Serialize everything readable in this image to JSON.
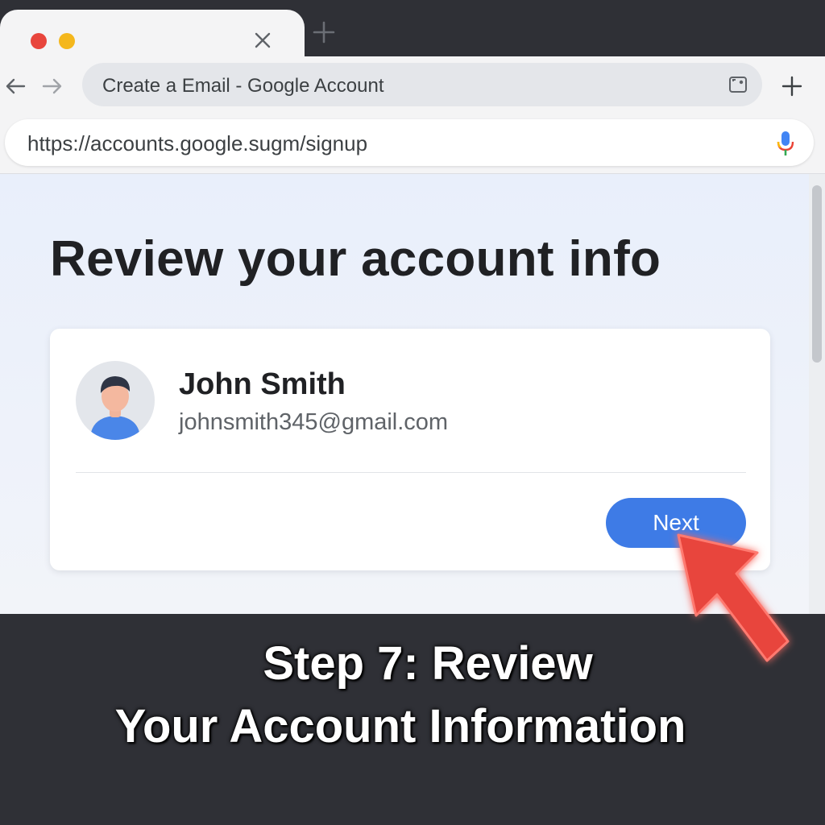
{
  "browser": {
    "tab_title": "Create a Email - Google Account",
    "url": "https://accounts.google.sugm/signup"
  },
  "page": {
    "heading": "Review your account info",
    "account": {
      "name": "John Smith",
      "email": "johnsmith345@gmail.com"
    },
    "next_button_label": "Next"
  },
  "caption": {
    "line1": "Step 7: Review",
    "line2": "Your Account Information"
  },
  "icons": {
    "close": "close-icon",
    "new_tab": "plus-icon",
    "back": "arrow-left-icon",
    "forward": "arrow-right-icon",
    "tab_action": "screenshot-icon",
    "mic": "microphone-icon",
    "pointer": "red-arrow-pointer-icon"
  },
  "colors": {
    "accent": "#3e7be6",
    "pointer": "#e8453c",
    "chrome_dark": "#2f3036"
  }
}
